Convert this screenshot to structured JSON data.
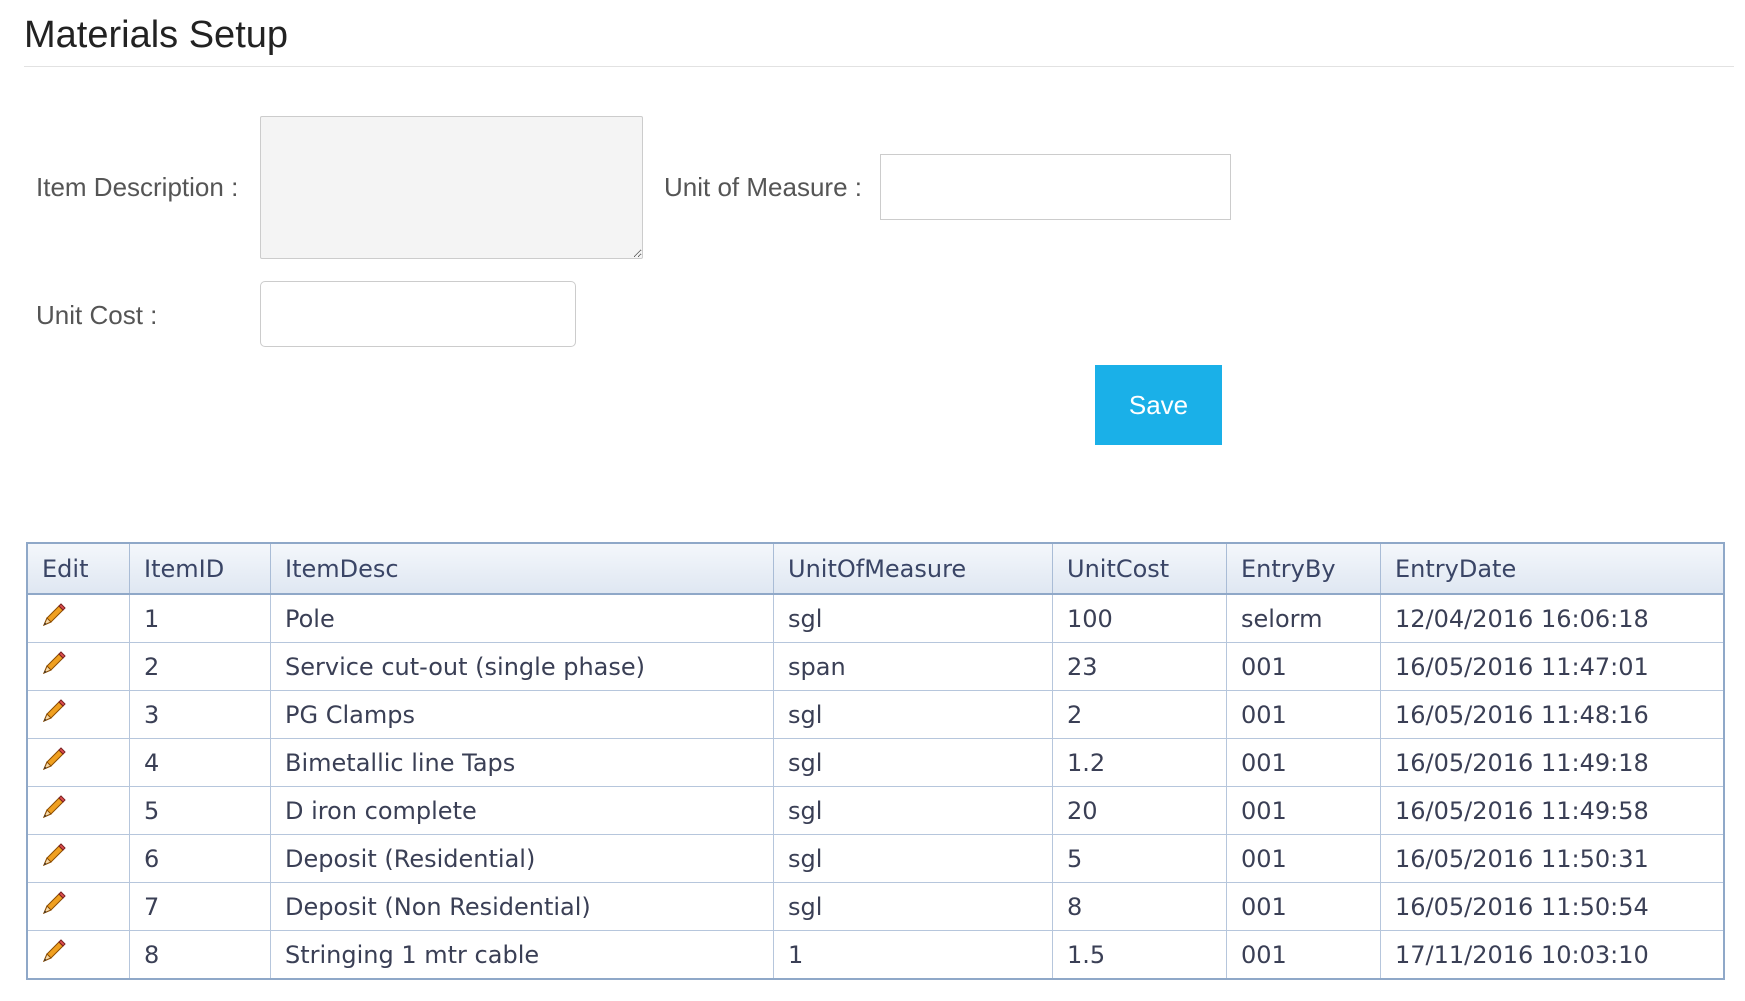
{
  "page": {
    "title": "Materials Setup"
  },
  "form": {
    "item_description_label": "Item Description :",
    "item_description_value": "",
    "unit_of_measure_label": "Unit of Measure :",
    "unit_of_measure_value": "",
    "unit_cost_label": "Unit Cost :",
    "unit_cost_value": "",
    "save_label": "Save"
  },
  "table": {
    "columns": [
      "Edit",
      "ItemID",
      "ItemDesc",
      "UnitOfMeasure",
      "UnitCost",
      "EntryBy",
      "EntryDate"
    ],
    "rows": [
      {
        "id": "1",
        "desc": "Pole",
        "uom": "sgl",
        "cost": "100",
        "by": "selorm",
        "date": "12/04/2016 16:06:18"
      },
      {
        "id": "2",
        "desc": "Service cut-out (single phase)",
        "uom": "span",
        "cost": "23",
        "by": "001",
        "date": "16/05/2016 11:47:01"
      },
      {
        "id": "3",
        "desc": "PG Clamps",
        "uom": "sgl",
        "cost": "2",
        "by": "001",
        "date": "16/05/2016 11:48:16"
      },
      {
        "id": "4",
        "desc": "Bimetallic line Taps",
        "uom": "sgl",
        "cost": "1.2",
        "by": "001",
        "date": "16/05/2016 11:49:18"
      },
      {
        "id": "5",
        "desc": "D iron complete",
        "uom": "sgl",
        "cost": "20",
        "by": "001",
        "date": "16/05/2016 11:49:58"
      },
      {
        "id": "6",
        "desc": "Deposit (Residential)",
        "uom": "sgl",
        "cost": "5",
        "by": "001",
        "date": "16/05/2016 11:50:31"
      },
      {
        "id": "7",
        "desc": "Deposit (Non Residential)",
        "uom": "sgl",
        "cost": "8",
        "by": "001",
        "date": "16/05/2016 11:50:54"
      },
      {
        "id": "8",
        "desc": "Stringing 1 mtr cable",
        "uom": "1",
        "cost": "1.5",
        "by": "001",
        "date": "17/11/2016 10:03:10"
      }
    ]
  },
  "icons": {
    "edit": "pencil-icon"
  },
  "colors": {
    "accent": "#1ab0e8",
    "grid_border": "#8fa8c8"
  }
}
